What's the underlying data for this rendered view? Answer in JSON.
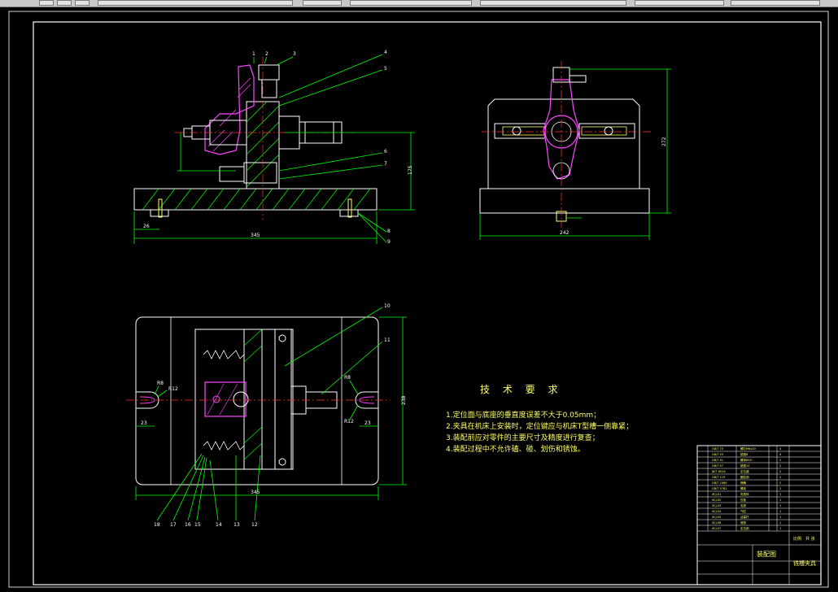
{
  "toolbar": {
    "description": "partially visible application toolbar strip (clipped at top)"
  },
  "drawing": {
    "technical_requirements_title": "技 术 要 求",
    "technical_requirements": [
      "1.定位面与底座的垂直度误差不大于0.05mm；",
      "2.夹具在机床上安装时，定位键应与机床T型槽一侧靠紧；",
      "3.装配前应对零件的主要尺寸及精度进行复查；",
      "4.装配过程中不允许磕、碰、划伤和锈蚀。"
    ],
    "dimensions": {
      "front_width": "345",
      "front_offset": "26",
      "front_height": "175",
      "side_width": "242",
      "side_height": "272",
      "plan_width": "345",
      "plan_height": "238",
      "plan_left_offset": "23",
      "plan_right_offset": "23",
      "radius_left_small": "R8",
      "radius_left_large": "R12",
      "radius_right_small": "R8",
      "radius_right_large": "R12"
    },
    "balloons_top": [
      "1",
      "2",
      "3",
      "4",
      "5",
      "6",
      "7",
      "8",
      "9"
    ],
    "balloons_bottom": [
      "10",
      "11",
      "12",
      "13",
      "14",
      "15",
      "16",
      "17",
      "18"
    ],
    "title_block": {
      "drawing_name": "装配图",
      "part_name": "铣槽夹具",
      "scale_label": "比例",
      "sheet_label": "共 张"
    }
  }
}
